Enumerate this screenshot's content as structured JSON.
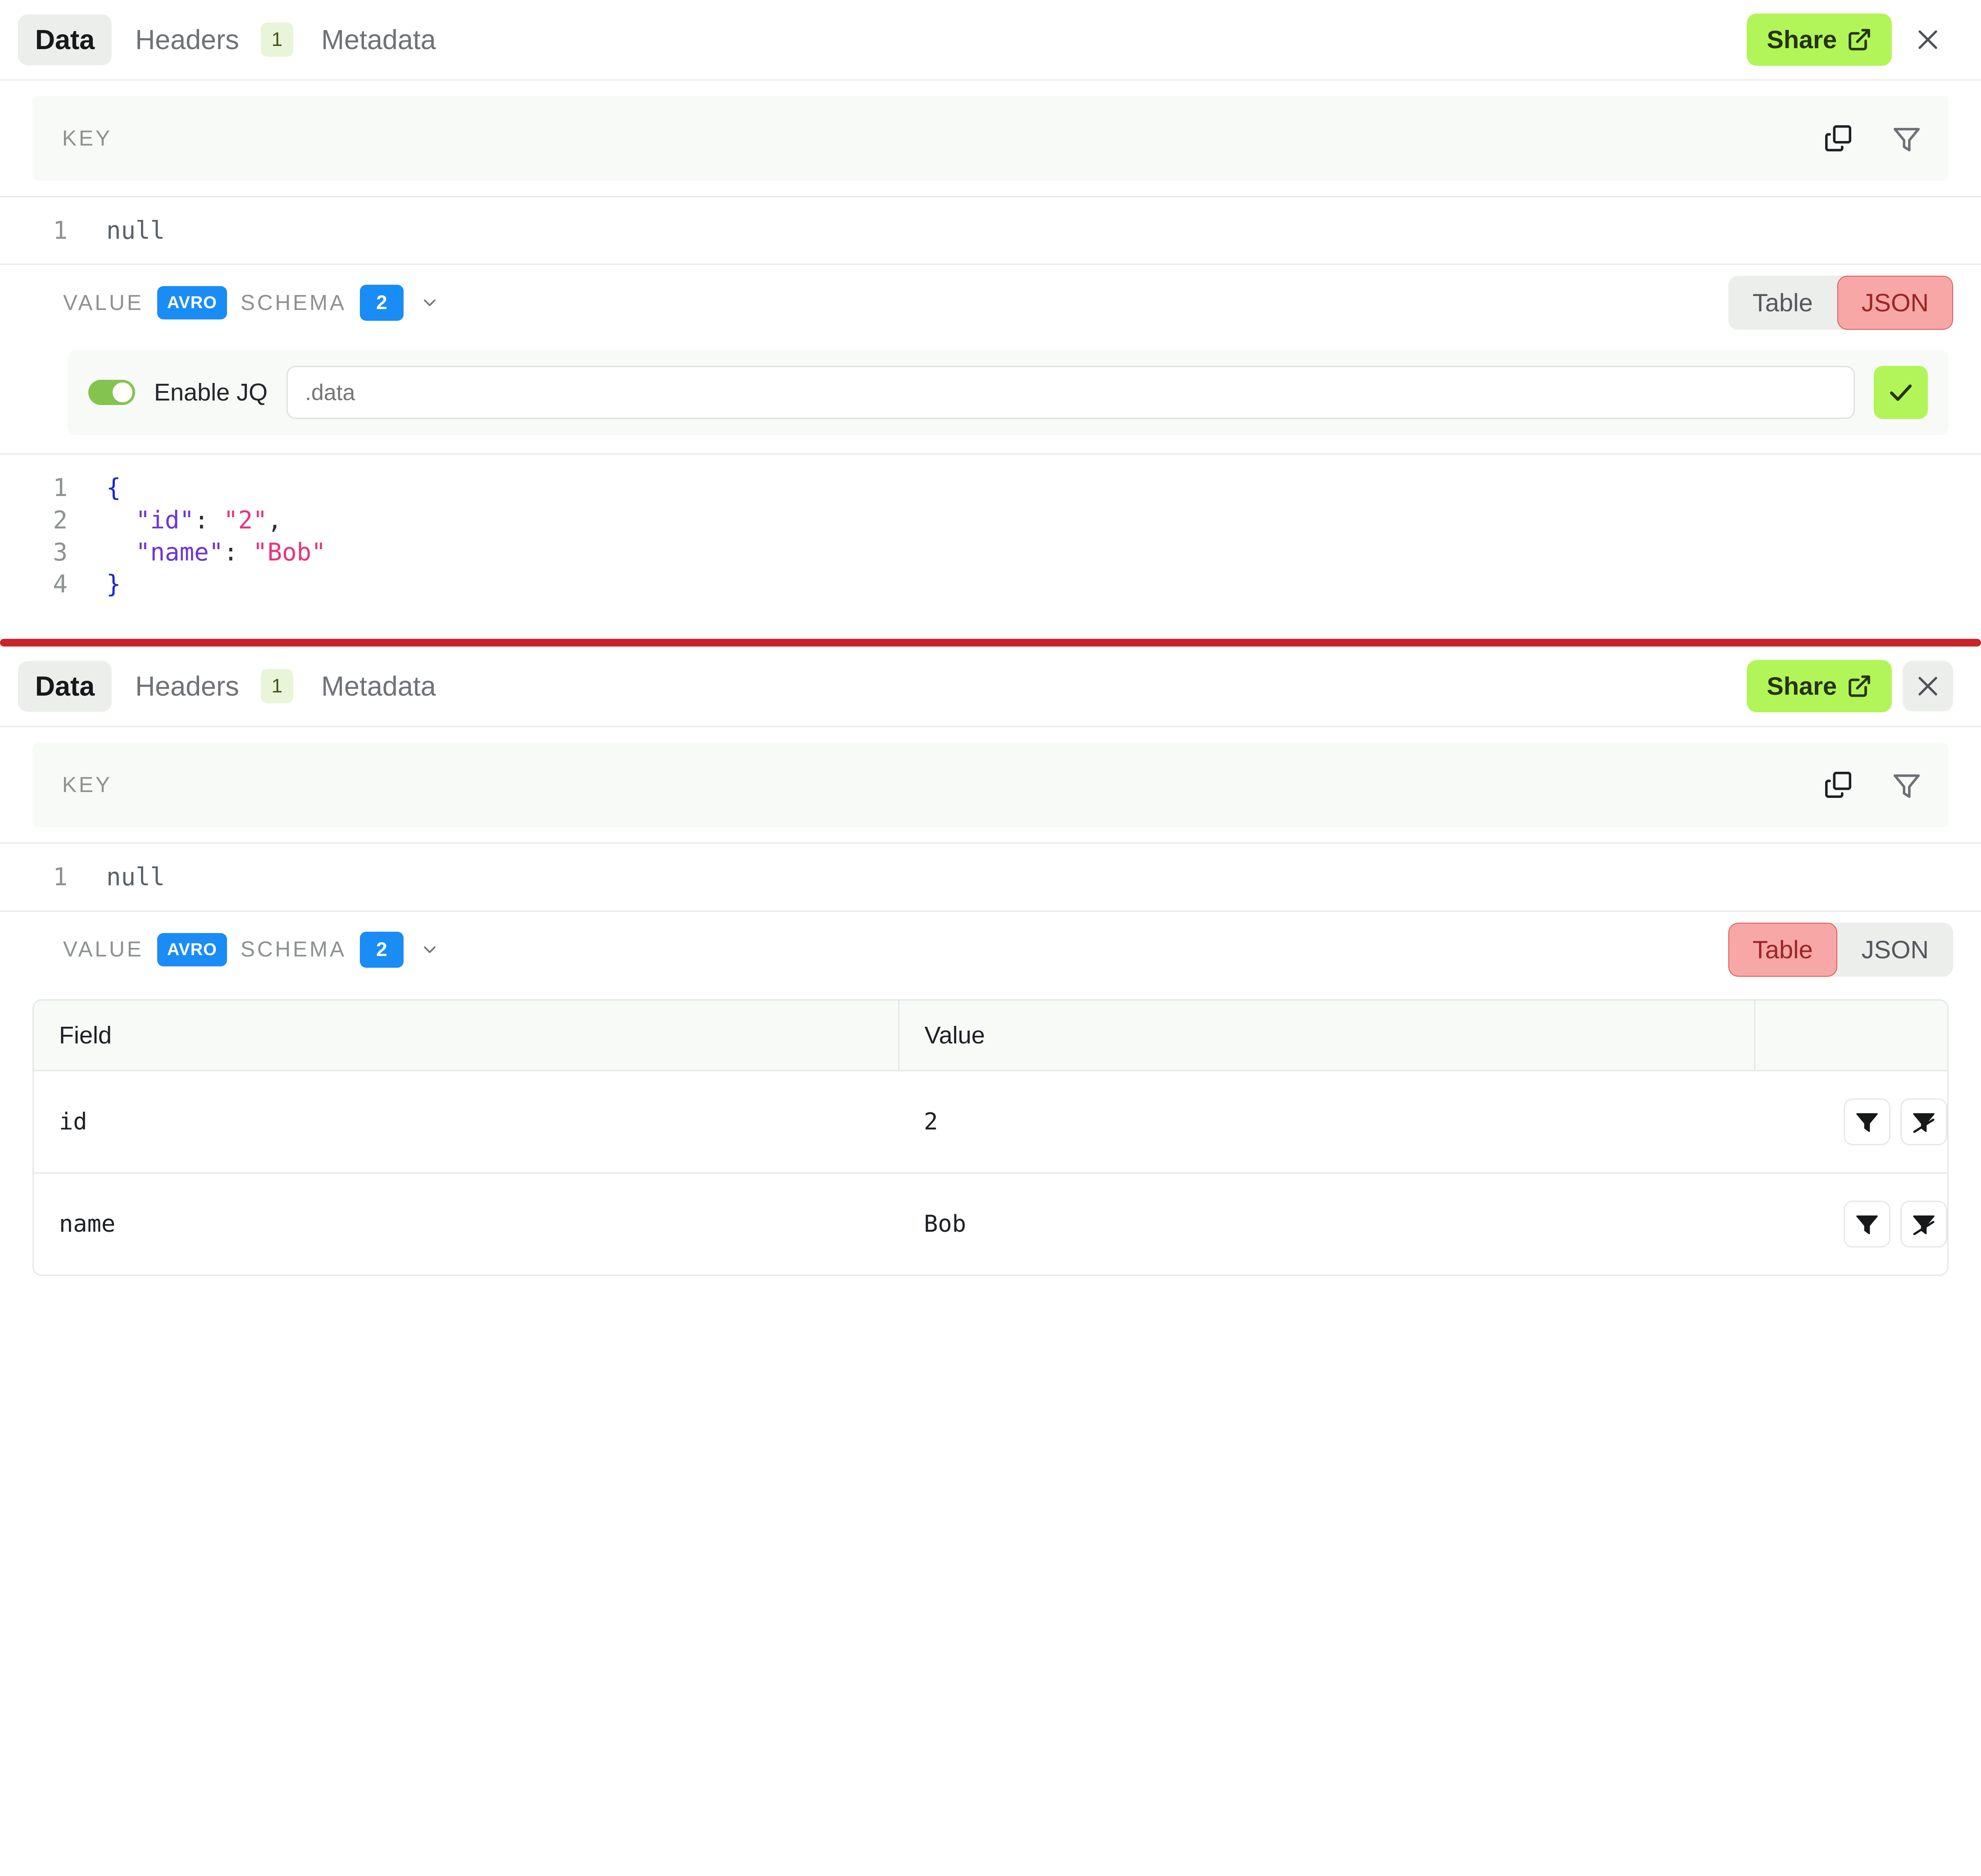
{
  "panels": [
    {
      "tabs": [
        {
          "label": "Data",
          "active": true
        },
        {
          "label": "Headers",
          "badge": "1",
          "active": false
        },
        {
          "label": "Metadata",
          "active": false
        }
      ],
      "share_label": "Share",
      "key_section": {
        "label": "KEY",
        "copy_icon": "copy-icon",
        "filter_icon": "filter-icon",
        "content_lines": [
          {
            "number": "1",
            "text": "null"
          }
        ]
      },
      "value_section": {
        "label": "VALUE",
        "format_badge": "AVRO",
        "schema_label": "SCHEMA",
        "schema_version": "2",
        "view_toggle": {
          "options": [
            "Table",
            "JSON"
          ],
          "selected": "JSON"
        }
      },
      "jq": {
        "enabled": true,
        "label": "Enable JQ",
        "value": ".data",
        "placeholder": ".data",
        "apply_icon": "check-icon"
      },
      "json_lines": [
        {
          "number": "1",
          "segments": [
            {
              "t": "{",
              "c": "tok-brace"
            }
          ]
        },
        {
          "number": "2",
          "segments": [
            {
              "t": "  ",
              "c": "tok-punct"
            },
            {
              "t": "\"id\"",
              "c": "tok-key"
            },
            {
              "t": ": ",
              "c": "tok-punct"
            },
            {
              "t": "\"2\"",
              "c": "tok-str"
            },
            {
              "t": ",",
              "c": "tok-punct"
            }
          ]
        },
        {
          "number": "3",
          "segments": [
            {
              "t": "  ",
              "c": "tok-punct"
            },
            {
              "t": "\"name\"",
              "c": "tok-key"
            },
            {
              "t": ": ",
              "c": "tok-punct"
            },
            {
              "t": "\"Bob\"",
              "c": "tok-str"
            }
          ]
        },
        {
          "number": "4",
          "segments": [
            {
              "t": "}",
              "c": "tok-brace"
            }
          ]
        }
      ]
    },
    {
      "tabs": [
        {
          "label": "Data",
          "active": true
        },
        {
          "label": "Headers",
          "badge": "1",
          "active": false
        },
        {
          "label": "Metadata",
          "active": false
        }
      ],
      "share_label": "Share",
      "key_section": {
        "label": "KEY",
        "copy_icon": "copy-icon",
        "filter_icon": "filter-icon",
        "content_lines": [
          {
            "number": "1",
            "text": "null"
          }
        ]
      },
      "value_section": {
        "label": "VALUE",
        "format_badge": "AVRO",
        "schema_label": "SCHEMA",
        "schema_version": "2",
        "view_toggle": {
          "options": [
            "Table",
            "JSON"
          ],
          "selected": "Table"
        }
      },
      "table": {
        "columns": [
          "Field",
          "Value",
          ""
        ],
        "rows": [
          {
            "field": "id",
            "value": "2"
          },
          {
            "field": "name",
            "value": "Bob"
          }
        ],
        "row_actions": [
          {
            "name": "filter-include-button",
            "icon": "filter-icon"
          },
          {
            "name": "filter-exclude-button",
            "icon": "filter-off-icon"
          }
        ]
      }
    }
  ],
  "colors": {
    "share_green": "#b2f558",
    "badge_blue": "#1a8cf5",
    "selected_pink": "#f8a7a7",
    "separator_red": "#cc2229",
    "toggle_green": "#85c34f",
    "tab_badge_green": "#e8f5d8"
  }
}
